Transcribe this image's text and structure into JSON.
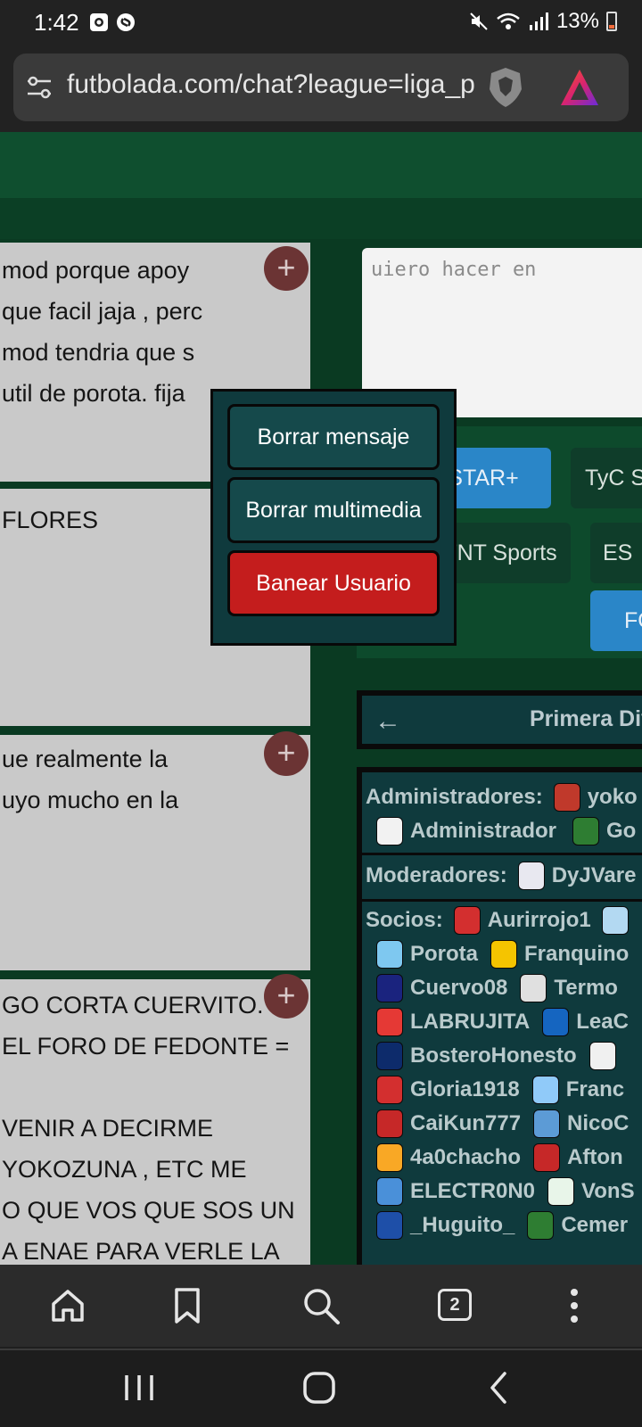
{
  "status": {
    "time": "1:42",
    "battery": "13%"
  },
  "browser": {
    "url": "futbolada.com/chat?league=liga_p",
    "tab_count": "2"
  },
  "chat": {
    "messages": [
      {
        "lines": [
          "mod porque apoy",
          "que facil jaja , perc",
          "mod tendria que s",
          "util de porota. fija"
        ]
      },
      {
        "lines": [
          "FLORES"
        ]
      },
      {
        "lines": [
          "ue realmente la",
          "uyo mucho en la"
        ]
      },
      {
        "lines": [
          "GO CORTA CUERVITO.",
          "EL FORO DE FEDONTE =",
          "",
          " VENIR A DECIRME",
          " YOKOZUNA , ETC ME",
          "O QUE VOS QUE SOS UN",
          "A ENAE PARA VERLE LA"
        ]
      }
    ],
    "composer_placeholder": "uiero hacer en"
  },
  "channels": {
    "items": [
      "STAR+",
      "TyC S",
      "TNT Sports",
      "ES",
      "FO"
    ],
    "accent_blue": "#2a86c8"
  },
  "league": {
    "title": "Primera Div"
  },
  "users": {
    "admins_label": "Administradores:",
    "admins": [
      "yoko",
      "Administrador",
      "Go"
    ],
    "mods_label": "Moderadores:",
    "mods": [
      "DyJVare"
    ],
    "socios_label": "Socios:",
    "socios": [
      [
        "Aurirrojo1"
      ],
      [
        "Porota",
        "Franquino"
      ],
      [
        "Cuervo08",
        "Termo"
      ],
      [
        "LABRUJITA",
        "LeaC"
      ],
      [
        "BosteroHonesto"
      ],
      [
        "Gloria1918",
        "Franc"
      ],
      [
        "CaiKun777",
        "NicoC"
      ],
      [
        "4a0chacho",
        "Afton"
      ],
      [
        "ELECTR0N0",
        "VonS"
      ],
      [
        "_Huguito_",
        "Cemer"
      ]
    ]
  },
  "context_menu": {
    "delete_message": "Borrar mensaje",
    "delete_media": "Borrar multimedia",
    "ban_user": "Banear Usuario",
    "danger_color": "#c41d1d"
  }
}
